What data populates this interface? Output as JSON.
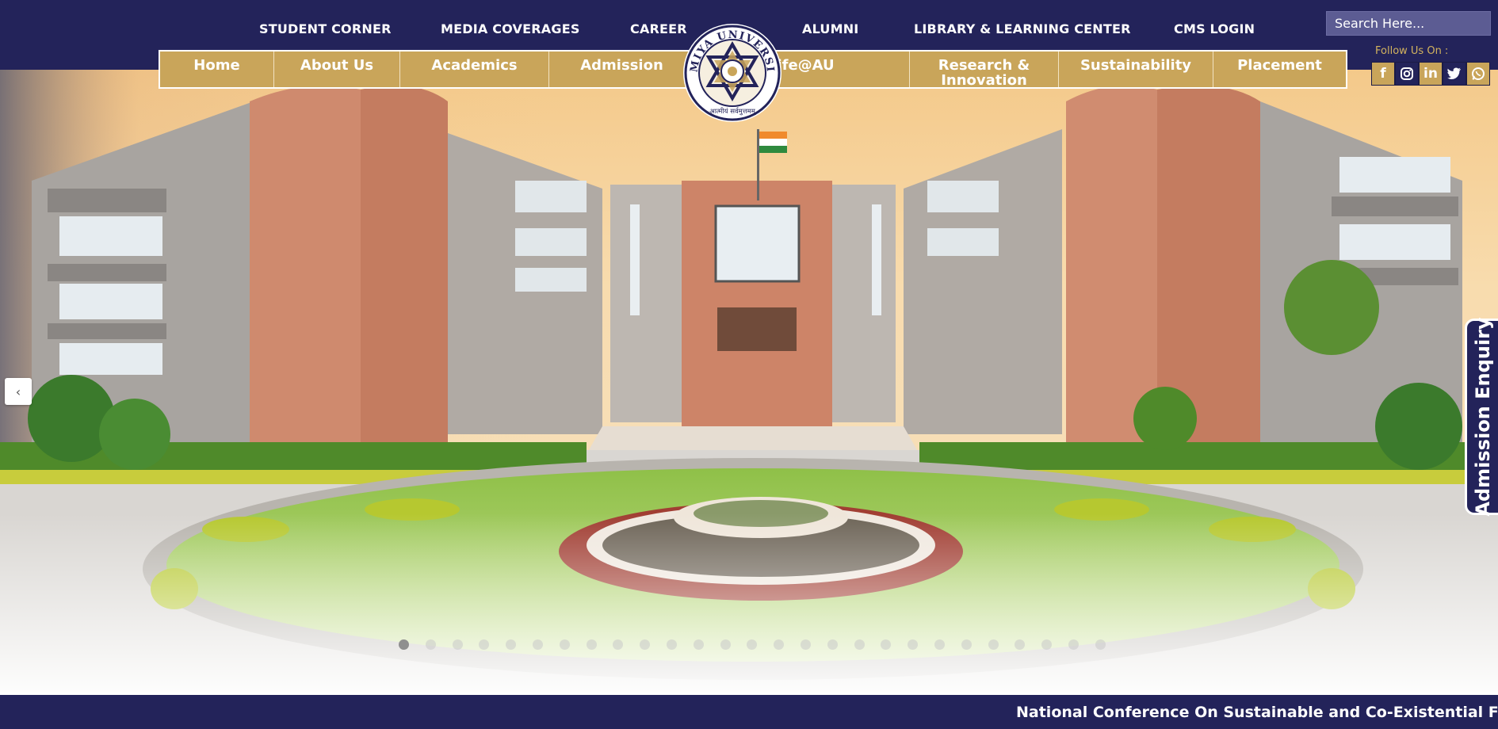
{
  "top_links": [
    "STUDENT CORNER",
    "MEDIA COVERAGES",
    "CAREER",
    "ALUMNI",
    "LIBRARY & LEARNING CENTER",
    "CMS LOGIN"
  ],
  "search": {
    "placeholder": "Search Here..."
  },
  "social": {
    "label": "Follow Us On :",
    "icons": [
      "facebook-icon",
      "instagram-icon",
      "linkedin-icon",
      "twitter-icon",
      "whatsapp-icon"
    ]
  },
  "main_nav": {
    "left": [
      "Home",
      "About Us",
      "Academics",
      "Admission"
    ],
    "right": [
      "Life@AU",
      "Research & Innovation",
      "Sustainability",
      "Placement"
    ]
  },
  "logo": {
    "name": "ATMIYA UNIVERSITY",
    "motto": "आत्मीयं सर्वमुत्तमम्"
  },
  "slider": {
    "prev_arrow": "‹",
    "dot_count": 27,
    "active_index": 0
  },
  "admission_enquiry": "Admission Enquiry",
  "ticker": "National Conference On Sustainable and Co-Existential Futur",
  "colors": {
    "navy": "#23235a",
    "gold": "#c9a55a",
    "white": "#ffffff"
  }
}
